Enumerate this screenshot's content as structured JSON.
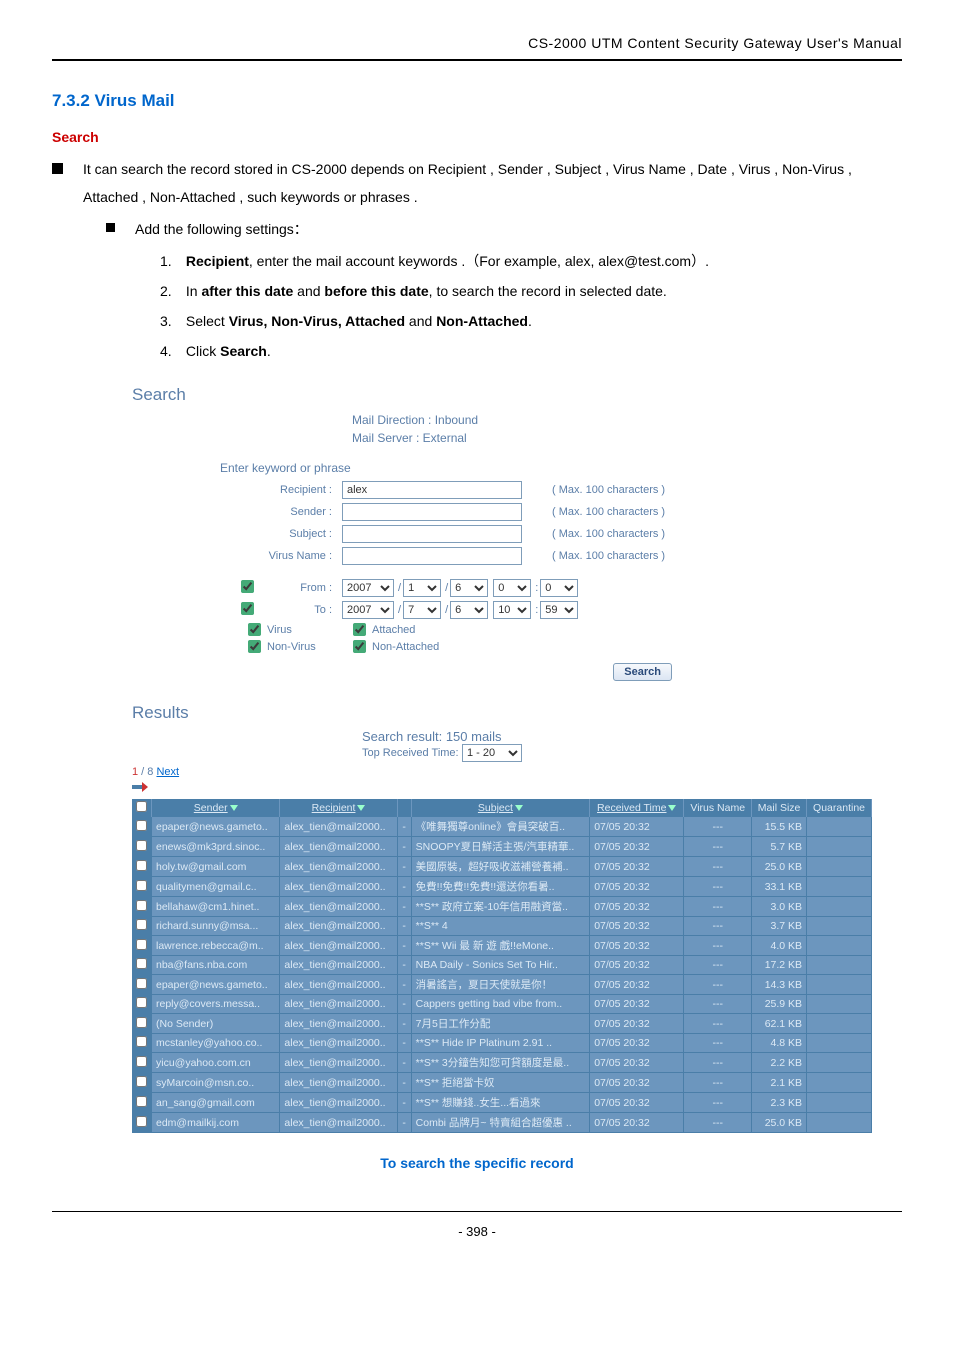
{
  "doc_header": "CS-2000 UTM Content Security Gateway User's Manual",
  "section_number": "7.3.2 Virus Mail",
  "search_heading": "Search",
  "intro": "It can search the record stored in CS-2000 depends on Recipient , Sender , Subject , Virus Name , Date , Virus , Non-Virus , Attached , Non-Attached , such keywords or phrases .",
  "sub_intro": "Add the following settings：",
  "steps": [
    {
      "n": "1.",
      "pre": "",
      "bold": "Recipient",
      "post": ", enter the mail account keywords .（For example, alex, alex@test.com）."
    },
    {
      "n": "2.",
      "pre": "In ",
      "bold": "after this date",
      "mid": " and ",
      "bold2": "before this date",
      "post": ", to search the record in selected date."
    },
    {
      "n": "3.",
      "pre": "Select ",
      "bold": "Virus, Non-Virus, Attached",
      "mid": " and ",
      "bold2": "Non-Attached",
      "post": "."
    },
    {
      "n": "4.",
      "pre": "Click ",
      "bold": "Search",
      "post": "."
    }
  ],
  "shot": {
    "title": "Search",
    "direction": "Mail Direction : Inbound",
    "server": "Mail Server : External",
    "enter_keyword": "Enter keyword or phrase",
    "labels": {
      "recipient": "Recipient :",
      "sender": "Sender :",
      "subject": "Subject :",
      "virus_name": "Virus Name :",
      "from": "From :",
      "to": "To :"
    },
    "recipient_value": "alex",
    "hint": "( Max. 100 characters )",
    "from_date": {
      "year": "2007",
      "mon": "1",
      "day": "6",
      "hour": "0",
      "min": "0"
    },
    "to_date": {
      "year": "2007",
      "mon": "7",
      "day": "6",
      "hour": "10",
      "min": "59"
    },
    "cb": {
      "virus": "Virus",
      "nonvirus": "Non-Virus",
      "attached": "Attached",
      "nonattached": "Non-Attached"
    },
    "search_btn": "Search"
  },
  "results": {
    "title": "Results",
    "result_text": "Search result: 150 mails",
    "top_received": "Top Received Time:",
    "top_received_val": "1 - 20",
    "pager_page": "1",
    "pager_total": " / 8   ",
    "pager_next": "Next",
    "headers": {
      "sender": "Sender",
      "recipient": "Recipient",
      "subject": "Subject",
      "received": "Received Time",
      "virus": "Virus Name",
      "size": "Mail Size",
      "quarantine": "Quarantine"
    },
    "rows": [
      {
        "sender": "epaper@news.gameto..",
        "recipient": "alex_tien@mail2000..",
        "att": "-",
        "subject": "《唯舞獨尊online》會員突破百..",
        "received": "07/05 20:32",
        "virus": "---",
        "size": "15.5 KB"
      },
      {
        "sender": "enews@mk3prd.sinoc..",
        "recipient": "alex_tien@mail2000..",
        "att": "-",
        "subject": "SNOOPY夏日鮮活主張/汽車精華..",
        "received": "07/05 20:32",
        "virus": "---",
        "size": "5.7 KB"
      },
      {
        "sender": "holy.tw@gmail.com",
        "recipient": "alex_tien@mail2000..",
        "att": "-",
        "subject": "美國原裝，超好吸收滋補營養補..",
        "received": "07/05 20:32",
        "virus": "---",
        "size": "25.0 KB"
      },
      {
        "sender": "qualitymen@gmail.c..",
        "recipient": "alex_tien@mail2000..",
        "att": "-",
        "subject": "免費!!免費!!免費!!還送你看暑..",
        "received": "07/05 20:32",
        "virus": "---",
        "size": "33.1 KB"
      },
      {
        "sender": "bellahaw@cm1.hinet..",
        "recipient": "alex_tien@mail2000..",
        "att": "-",
        "subject": "**S** 政府立案-10年信用融資當..",
        "received": "07/05 20:32",
        "virus": "---",
        "size": "3.0 KB"
      },
      {
        "sender": "richard.sunny@msa...",
        "recipient": "alex_tien@mail2000..",
        "att": "-",
        "subject": "**S** 4",
        "received": "07/05 20:32",
        "virus": "---",
        "size": "3.7 KB"
      },
      {
        "sender": "lawrence.rebecca@m..",
        "recipient": "alex_tien@mail2000..",
        "att": "-",
        "subject": "**S** Wii 最 新 遊 戲!!eMone..",
        "received": "07/05 20:32",
        "virus": "---",
        "size": "4.0 KB"
      },
      {
        "sender": "nba@fans.nba.com",
        "recipient": "alex_tien@mail2000..",
        "att": "-",
        "subject": "NBA Daily - Sonics Set To Hir..",
        "received": "07/05 20:32",
        "virus": "---",
        "size": "17.2 KB"
      },
      {
        "sender": "epaper@news.gameto..",
        "recipient": "alex_tien@mail2000..",
        "att": "-",
        "subject": "消暑謠言，夏日天使就是你！",
        "received": "07/05 20:32",
        "virus": "---",
        "size": "14.3 KB"
      },
      {
        "sender": "reply@covers.messa..",
        "recipient": "alex_tien@mail2000..",
        "att": "-",
        "subject": "Cappers getting bad vibe from..",
        "received": "07/05 20:32",
        "virus": "---",
        "size": "25.9 KB"
      },
      {
        "sender": "(No Sender)",
        "recipient": "alex_tien@mail2000..",
        "att": "-",
        "subject": "7月5日工作分配",
        "received": "07/05 20:32",
        "virus": "---",
        "size": "62.1 KB"
      },
      {
        "sender": "mcstanley@yahoo.co..",
        "recipient": "alex_tien@mail2000..",
        "att": "-",
        "subject": "**S** Hide IP Platinum 2.91 ..",
        "received": "07/05 20:32",
        "virus": "---",
        "size": "4.8 KB"
      },
      {
        "sender": "yicu@yahoo.com.cn",
        "recipient": "alex_tien@mail2000..",
        "att": "-",
        "subject": "**S** 3分鐘告知您可貸額度是最..",
        "received": "07/05 20:32",
        "virus": "---",
        "size": "2.2 KB"
      },
      {
        "sender": "syMarcoin@msn.co..",
        "recipient": "alex_tien@mail2000..",
        "att": "-",
        "subject": "**S** 拒絕當卡奴",
        "received": "07/05 20:32",
        "virus": "---",
        "size": "2.1 KB"
      },
      {
        "sender": "an_sang@gmail.com",
        "recipient": "alex_tien@mail2000..",
        "att": "-",
        "subject": "**S** 想賺錢..女生...看過來",
        "received": "07/05 20:32",
        "virus": "---",
        "size": "2.3 KB"
      },
      {
        "sender": "edm@mailkij.com",
        "recipient": "alex_tien@mail2000..",
        "att": "-",
        "subject": "Combi 品牌月~ 特賣組合超優惠 ..",
        "received": "07/05 20:32",
        "virus": "---",
        "size": "25.0 KB"
      }
    ]
  },
  "caption": "To search the specific record",
  "page_num": "- 398 -"
}
